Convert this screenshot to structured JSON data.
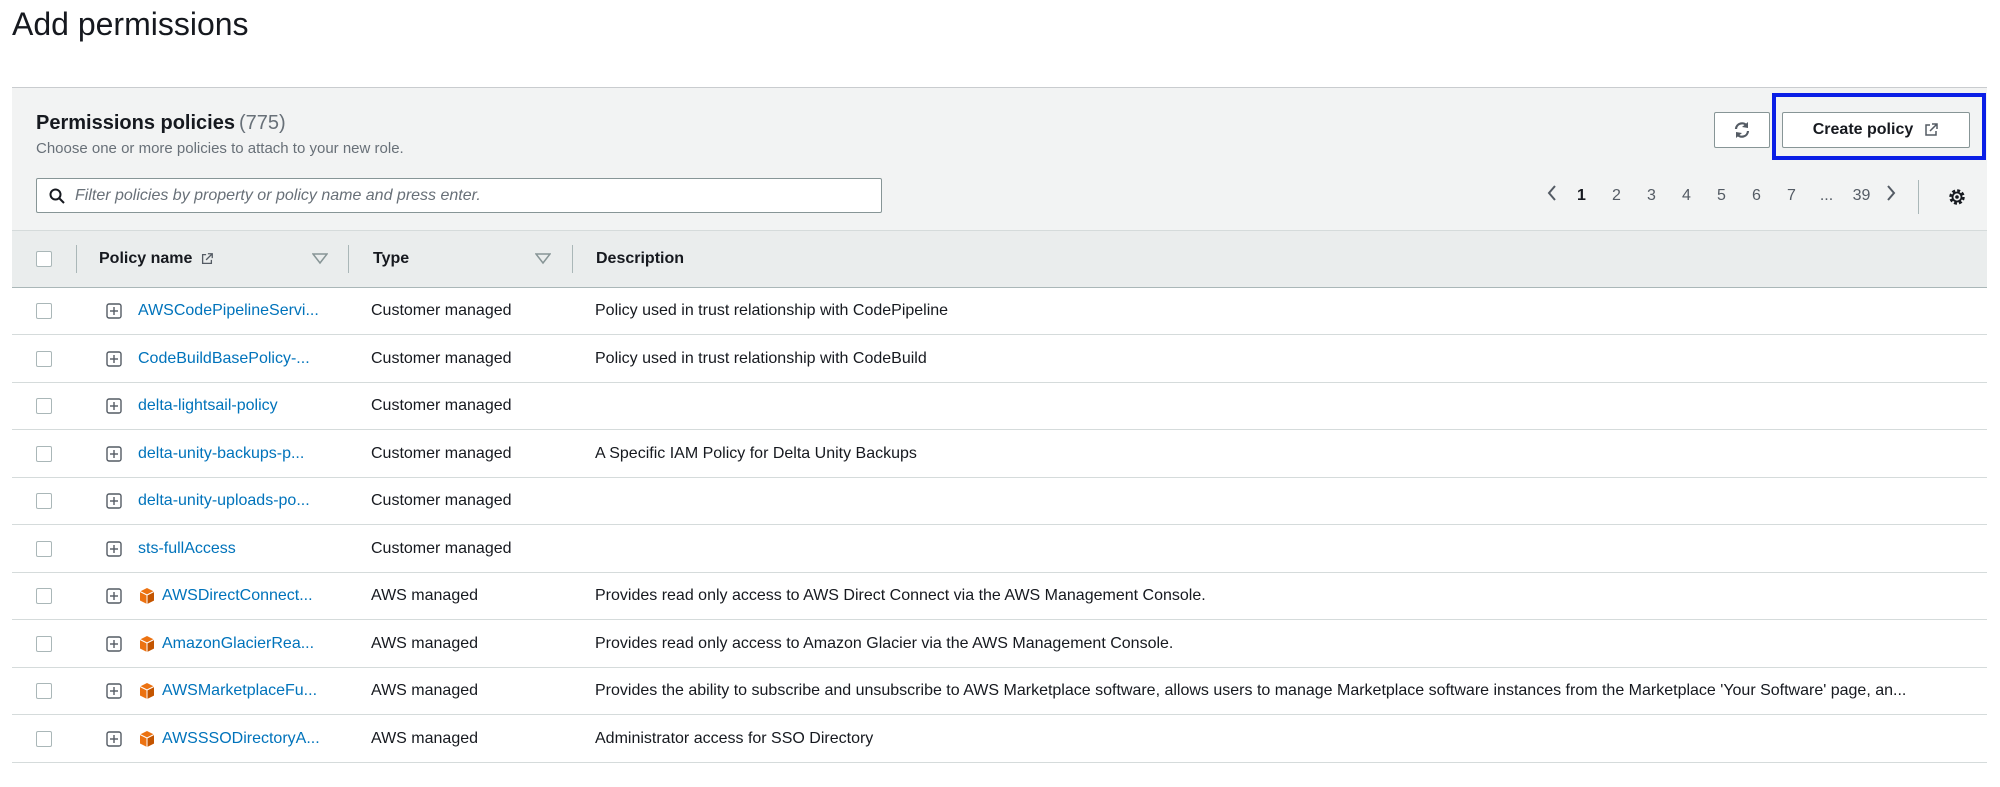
{
  "page": {
    "title": "Add permissions"
  },
  "panel": {
    "title": "Permissions policies",
    "count": "(775)",
    "description": "Choose one or more policies to attach to your new role.",
    "create_policy_label": "Create policy"
  },
  "search": {
    "placeholder": "Filter policies by property or policy name and press enter."
  },
  "pagination": {
    "pages": [
      "1",
      "2",
      "3",
      "4",
      "5",
      "6",
      "7",
      "...",
      "39"
    ],
    "current": "1"
  },
  "table": {
    "columns": {
      "name": "Policy name",
      "type": "Type",
      "description": "Description"
    },
    "rows": [
      {
        "name": "AWSCodePipelineServi...",
        "aws": false,
        "type": "Customer managed",
        "description": "Policy used in trust relationship with CodePipeline"
      },
      {
        "name": "CodeBuildBasePolicy-...",
        "aws": false,
        "type": "Customer managed",
        "description": "Policy used in trust relationship with CodeBuild"
      },
      {
        "name": "delta-lightsail-policy",
        "aws": false,
        "type": "Customer managed",
        "description": ""
      },
      {
        "name": "delta-unity-backups-p...",
        "aws": false,
        "type": "Customer managed",
        "description": "A Specific IAM Policy for Delta Unity Backups"
      },
      {
        "name": "delta-unity-uploads-po...",
        "aws": false,
        "type": "Customer managed",
        "description": ""
      },
      {
        "name": "sts-fullAccess",
        "aws": false,
        "type": "Customer managed",
        "description": ""
      },
      {
        "name": "AWSDirectConnect...",
        "aws": true,
        "type": "AWS managed",
        "description": "Provides read only access to AWS Direct Connect via the AWS Management Console."
      },
      {
        "name": "AmazonGlacierRea...",
        "aws": true,
        "type": "AWS managed",
        "description": "Provides read only access to Amazon Glacier via the AWS Management Console."
      },
      {
        "name": "AWSMarketplaceFu...",
        "aws": true,
        "type": "AWS managed",
        "description": "Provides the ability to subscribe and unsubscribe to AWS Marketplace software, allows users to manage Marketplace software instances from the Marketplace 'Your Software' page, an..."
      },
      {
        "name": "AWSSSODirectoryA...",
        "aws": true,
        "type": "AWS managed",
        "description": "Administrator access for SSO Directory"
      }
    ]
  },
  "colors": {
    "link": "#0073bb",
    "aws_icon": "#ec7211",
    "highlight": "#0a1ee6"
  }
}
